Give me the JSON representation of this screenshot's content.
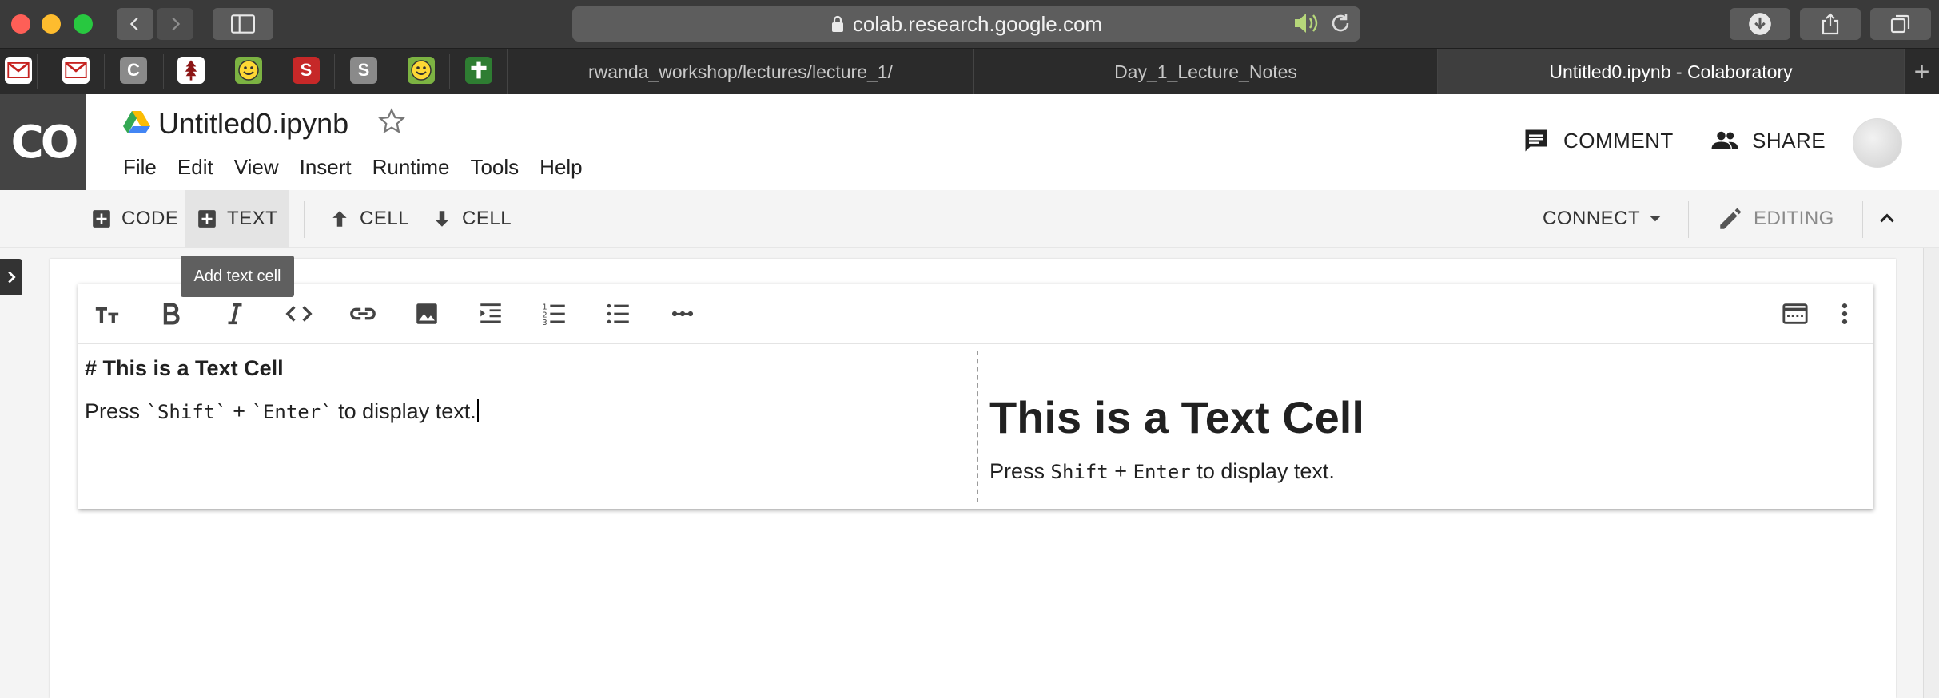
{
  "browser": {
    "url": "colab.research.google.com",
    "bookmarks": [
      {
        "label": "",
        "icon": "gmail-icon",
        "color": "#c5221f"
      },
      {
        "label": "",
        "icon": "gmail-icon",
        "color": "#c5221f"
      },
      {
        "label": "C",
        "icon": "c-letter-icon",
        "color": "#8a8a8a"
      },
      {
        "label": "",
        "icon": "stanford-tree-icon",
        "color": "#8c1515"
      },
      {
        "label": "",
        "icon": "smiley-icon",
        "color": "#7cb342"
      },
      {
        "label": "S",
        "icon": "s-letter-icon",
        "color": "#c62828"
      },
      {
        "label": "S",
        "icon": "s-letter-icon",
        "color": "#8a8a8a"
      },
      {
        "label": "",
        "icon": "smiley-icon",
        "color": "#7cb342"
      },
      {
        "label": "",
        "icon": "plus-cross-icon",
        "color": "#2e7d32"
      }
    ],
    "tabs": [
      {
        "label": "rwanda_workshop/lectures/lecture_1/",
        "active": false
      },
      {
        "label": "Day_1_Lecture_Notes",
        "active": false
      },
      {
        "label": "Untitled0.ipynb - Colaboratory",
        "active": true
      }
    ]
  },
  "colab": {
    "logo": "CO",
    "doc_title": "Untitled0.ipynb",
    "menu": [
      "File",
      "Edit",
      "View",
      "Insert",
      "Runtime",
      "Tools",
      "Help"
    ],
    "comment_label": "COMMENT",
    "share_label": "SHARE"
  },
  "toolbar": {
    "add_code": "CODE",
    "add_text": "TEXT",
    "cell_up": "CELL",
    "cell_down": "CELL",
    "connect": "CONNECT",
    "editing": "EDITING",
    "tooltip": "Add text cell"
  },
  "cell": {
    "source_heading": "# This is a Text Cell",
    "source_body_pre": "Press ",
    "source_code1": "`Shift`",
    "source_plus": " + ",
    "source_code2": "`Enter`",
    "source_body_post": " to display text.",
    "preview_heading": "This is a Text Cell",
    "preview_pre": "Press ",
    "preview_code1": "Shift",
    "preview_plus": " + ",
    "preview_code2": "Enter",
    "preview_post": " to display text."
  },
  "colors": {
    "accent_active_tab": "#3e3e3e",
    "colab_logo_bg": "#444444"
  }
}
